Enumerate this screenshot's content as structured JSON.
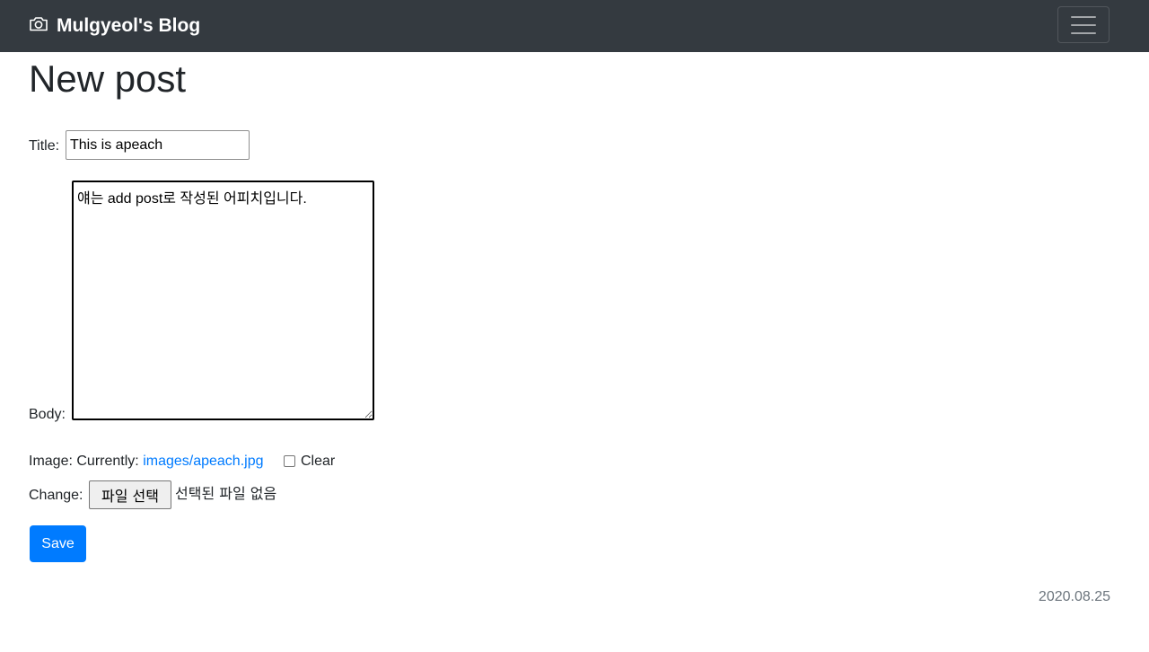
{
  "navbar": {
    "brand": "Mulgyeol's Blog",
    "brand_icon": "camera-icon",
    "toggler_icon": "hamburger-menu-icon"
  },
  "page": {
    "title": "New post"
  },
  "form": {
    "title_label": "Title:",
    "title_value": "This is apeach",
    "body_label": "Body:",
    "body_value": "얘는 add post로 작성된 어피치입니다.",
    "image_label": "Image:",
    "currently_label": "Currently:",
    "current_image": "images/apeach.jpg",
    "clear_label": "Clear",
    "clear_checked": false,
    "change_label": "Change:",
    "file_button": "파일 선택",
    "file_status": "선택된 파일 없음",
    "save_button": "Save"
  },
  "footer": {
    "date": "2020.08.25"
  },
  "colors": {
    "navbar": "#343a40",
    "primary": "#007bff",
    "muted": "#6c757d"
  }
}
